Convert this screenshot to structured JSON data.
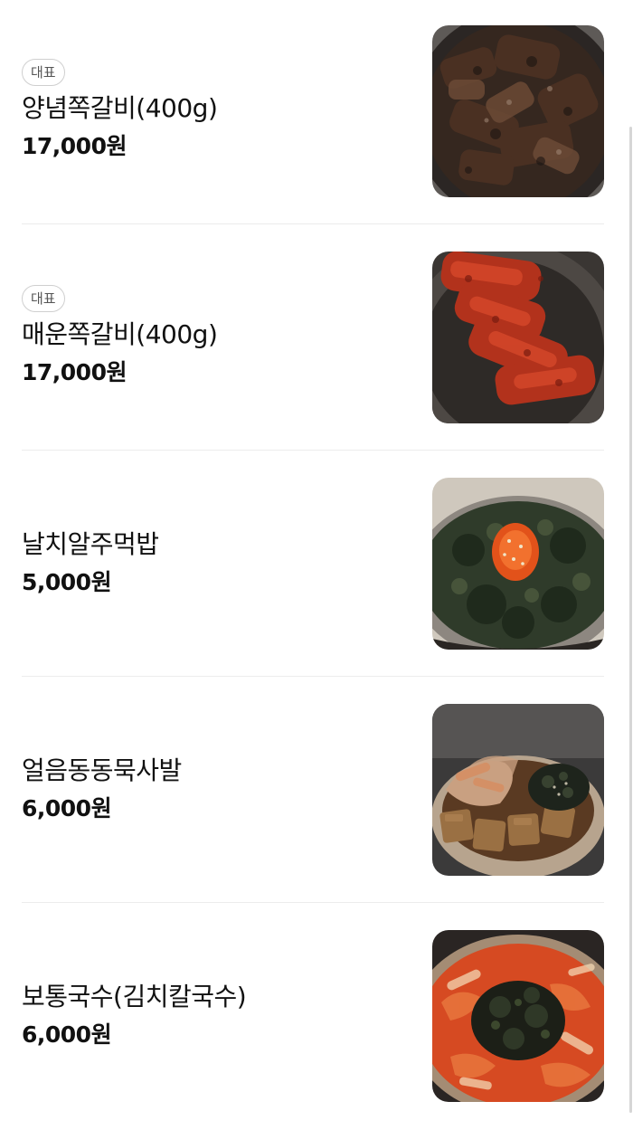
{
  "menu": {
    "items": [
      {
        "badge": "대표",
        "name": "양념쪽갈비(400g)",
        "price": "17,000원",
        "photo": "grilled-pork-ribs"
      },
      {
        "badge": "대표",
        "name": "매운쪽갈비(400g)",
        "price": "17,000원",
        "photo": "spicy-pork-ribs"
      },
      {
        "name": "날치알주먹밥",
        "price": "5,000원",
        "photo": "flying-fish-roe-rice-ball"
      },
      {
        "name": "얼음동동묵사발",
        "price": "6,000원",
        "photo": "iced-acorn-jelly-bowl"
      },
      {
        "name": "보통국수(김치칼국수)",
        "price": "6,000원",
        "photo": "kimchi-noodle-soup"
      }
    ]
  }
}
